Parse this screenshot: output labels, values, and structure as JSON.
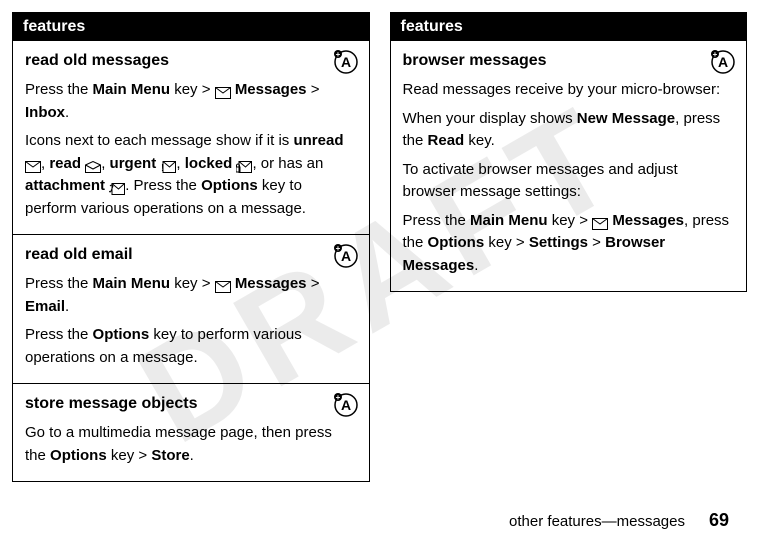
{
  "watermark": "DRAFT",
  "left": {
    "header": "features",
    "sections": [
      {
        "title": "read old messages",
        "line1_a": "Press the ",
        "line1_b": "Main Menu",
        "line1_c": " key > ",
        "line1_d": "Messages",
        "line1_e": " > ",
        "line1_f": "Inbox",
        "line1_g": ".",
        "line2_a": "Icons next to each message show if it is ",
        "line2_b": "unread",
        "line2_c": ", ",
        "line2_d": "read",
        "line2_e": ", ",
        "line2_f": "urgent",
        "line2_g": ", ",
        "line2_h": "locked",
        "line2_i": ", or has an ",
        "line2_j": "attachment",
        "line2_k": ". Press the ",
        "line2_l": "Options",
        "line2_m": " key to perform various operations on a message."
      },
      {
        "title": "read old email",
        "line1_a": "Press the ",
        "line1_b": "Main Menu",
        "line1_c": " key > ",
        "line1_d": "Messages",
        "line1_e": " > ",
        "line1_f": "Email",
        "line1_g": ".",
        "line2_a": "Press the ",
        "line2_b": "Options",
        "line2_c": " key to perform various operations on a message."
      },
      {
        "title": "store message objects",
        "line1_a": "Go to a multimedia message page, then press the ",
        "line1_b": "Options",
        "line1_c": " key > ",
        "line1_d": "Store",
        "line1_e": "."
      }
    ]
  },
  "right": {
    "header": "features",
    "sections": [
      {
        "title": "browser messages",
        "line1": "Read messages receive by your micro-browser:",
        "line2_a": "When your display shows ",
        "line2_b": "New Message",
        "line2_c": ", press the ",
        "line2_d": "Read",
        "line2_e": " key.",
        "line3": "To activate browser messages and adjust browser message settings:",
        "line4_a": "Press the ",
        "line4_b": "Main Menu",
        "line4_c": " key > ",
        "line4_d": "Messages",
        "line4_e": ", press the ",
        "line4_f": "Options",
        "line4_g": " key > ",
        "line4_h": "Settings",
        "line4_i": " > ",
        "line4_j": "Browser Messages",
        "line4_k": "."
      }
    ]
  },
  "footer": {
    "text": "other features—messages",
    "page": "69"
  }
}
